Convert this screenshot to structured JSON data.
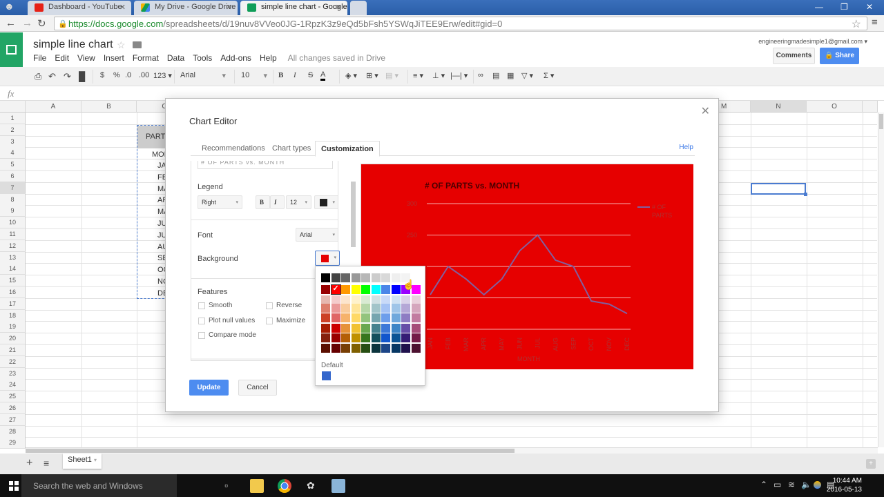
{
  "browser": {
    "tabs": [
      {
        "label": "Dashboard - YouTube",
        "icon": "youtube-icon",
        "color": "#e62117"
      },
      {
        "label": "My Drive - Google Drive",
        "icon": "drive-icon",
        "color": "#f4b400"
      },
      {
        "label": "simple line chart - Google",
        "icon": "sheets-icon",
        "color": "#0f9d58",
        "active": true
      }
    ],
    "url_host": "https://docs.google.com",
    "url_path": "/spreadsheets/d/19nuv8VVeo0JG-1RpzK3z9eQd5bFsh5YSWqJiTEE9Erw/edit#gid=0"
  },
  "app": {
    "doc_title": "simple line chart",
    "menu": [
      "File",
      "Edit",
      "View",
      "Insert",
      "Format",
      "Data",
      "Tools",
      "Add-ons",
      "Help"
    ],
    "save_status": "All changes saved in Drive",
    "account_email": "engineeringmadesimple1@gmail.com",
    "comments_label": "Comments",
    "share_label": "Share"
  },
  "toolbar": {
    "currency": "$",
    "percent": "%",
    "dec_decrease": ".0",
    "dec_increase": ".00",
    "more_formats": "123",
    "font": "Arial",
    "font_size": "10",
    "bold": "B",
    "italic": "I",
    "strike": "S",
    "text_color": "A"
  },
  "formula_bar": {
    "label": "fx",
    "value": ""
  },
  "grid": {
    "columns_left": [
      "A",
      "B",
      "C"
    ],
    "columns_right": [
      "M",
      "N",
      "O"
    ],
    "rows": [
      "1",
      "2",
      "3",
      "4",
      "5",
      "6",
      "7",
      "8",
      "9",
      "10",
      "11",
      "12",
      "13",
      "14",
      "15",
      "16",
      "17",
      "18",
      "19",
      "20",
      "21",
      "22",
      "23",
      "24",
      "25",
      "26",
      "27",
      "28",
      "29"
    ],
    "selected_row": "7",
    "selected_col": "N",
    "partial_cells": {
      "header": "PART",
      "col_header": "MON",
      "months": [
        "JA",
        "FE",
        "MA",
        "AP",
        "MA",
        "JU",
        "JU",
        "AU",
        "SE",
        "OC",
        "NO",
        "DE"
      ]
    }
  },
  "sheets": {
    "tabs": [
      "Sheet1"
    ]
  },
  "taskbar": {
    "search_placeholder": "Search the web and Windows",
    "time": "10:44 AM",
    "date": "2016-05-13"
  },
  "chart_editor": {
    "title": "Chart Editor",
    "tabs": [
      "Recommendations",
      "Chart types",
      "Customization"
    ],
    "active_tab": "Customization",
    "help_label": "Help",
    "title_field_value": "# OF PARTS vs. MONTH",
    "legend_label": "Legend",
    "legend_position": "Right",
    "legend_bold": "B",
    "legend_italic": "I",
    "legend_font_size": "12",
    "legend_color": "#222222",
    "font_label": "Font",
    "font_value": "Arial",
    "background_label": "Background",
    "background_color": "#e60000",
    "features_label": "Features",
    "features": [
      {
        "label": "Smooth",
        "checked": false
      },
      {
        "label": "Reverse",
        "checked": false
      },
      {
        "label": "Plot null values",
        "checked": false
      },
      {
        "label": "Maximize",
        "checked": false
      },
      {
        "label": "Compare mode",
        "checked": false
      }
    ],
    "update_label": "Update",
    "cancel_label": "Cancel",
    "palette": {
      "grays": [
        "#000000",
        "#434343",
        "#666666",
        "#999999",
        "#b7b7b7",
        "#cccccc",
        "#d9d9d9",
        "#efefef",
        "#f3f3f3",
        "#ffffff"
      ],
      "brights": [
        "#980000",
        "#ff0000",
        "#ff9900",
        "#ffff00",
        "#00ff00",
        "#00ffff",
        "#4a86e8",
        "#0000ff",
        "#9900ff",
        "#ff00ff"
      ],
      "shades": [
        [
          "#e6b8af",
          "#f4cccc",
          "#fce5cd",
          "#fff2cc",
          "#d9ead3",
          "#d0e0e3",
          "#c9daf8",
          "#cfe2f3",
          "#d9d2e9",
          "#ead1dc"
        ],
        [
          "#dd7e6b",
          "#ea9999",
          "#f9cb9c",
          "#ffe599",
          "#b6d7a8",
          "#a2c4c9",
          "#a4c2f4",
          "#9fc5e8",
          "#b4a7d6",
          "#d5a6bd"
        ],
        [
          "#cc4125",
          "#e06666",
          "#f6b26b",
          "#ffd966",
          "#93c47d",
          "#76a5af",
          "#6d9eeb",
          "#6fa8dc",
          "#8e7cc3",
          "#c27ba0"
        ],
        [
          "#a61c00",
          "#cc0000",
          "#e69138",
          "#f1c232",
          "#6aa84f",
          "#45818e",
          "#3c78d8",
          "#3d85c6",
          "#674ea7",
          "#a64d79"
        ],
        [
          "#85200c",
          "#990000",
          "#b45f06",
          "#bf9000",
          "#38761d",
          "#134f5c",
          "#1155cc",
          "#0b5394",
          "#351c75",
          "#741b47"
        ],
        [
          "#5b0f00",
          "#660000",
          "#783f04",
          "#7f6000",
          "#274e13",
          "#0c343d",
          "#1c4587",
          "#073763",
          "#20124d",
          "#4c1130"
        ]
      ],
      "selected": "#ff0000",
      "default_label": "Default",
      "default_color": "#3366cc"
    }
  },
  "chart_data": {
    "type": "line",
    "title": "# OF PARTS vs. MONTH",
    "xlabel": "MONTH",
    "ylabel": "# OF PARTS",
    "categories": [
      "JAN",
      "FEB",
      "MAR",
      "APR",
      "MAY",
      "JUN",
      "JUL",
      "AUG",
      "SEP",
      "OCT",
      "NOV",
      "DEC"
    ],
    "series": [
      {
        "name": "# OF PARTS",
        "color": "#8060a0",
        "values": [
          155,
          200,
          180,
          155,
          180,
          225,
          250,
          210,
          200,
          145,
          140,
          125
        ]
      }
    ],
    "ylim": [
      100,
      300
    ],
    "yticks": [
      300,
      250
    ],
    "grid": true,
    "legend": "right",
    "background": "#e60000"
  }
}
